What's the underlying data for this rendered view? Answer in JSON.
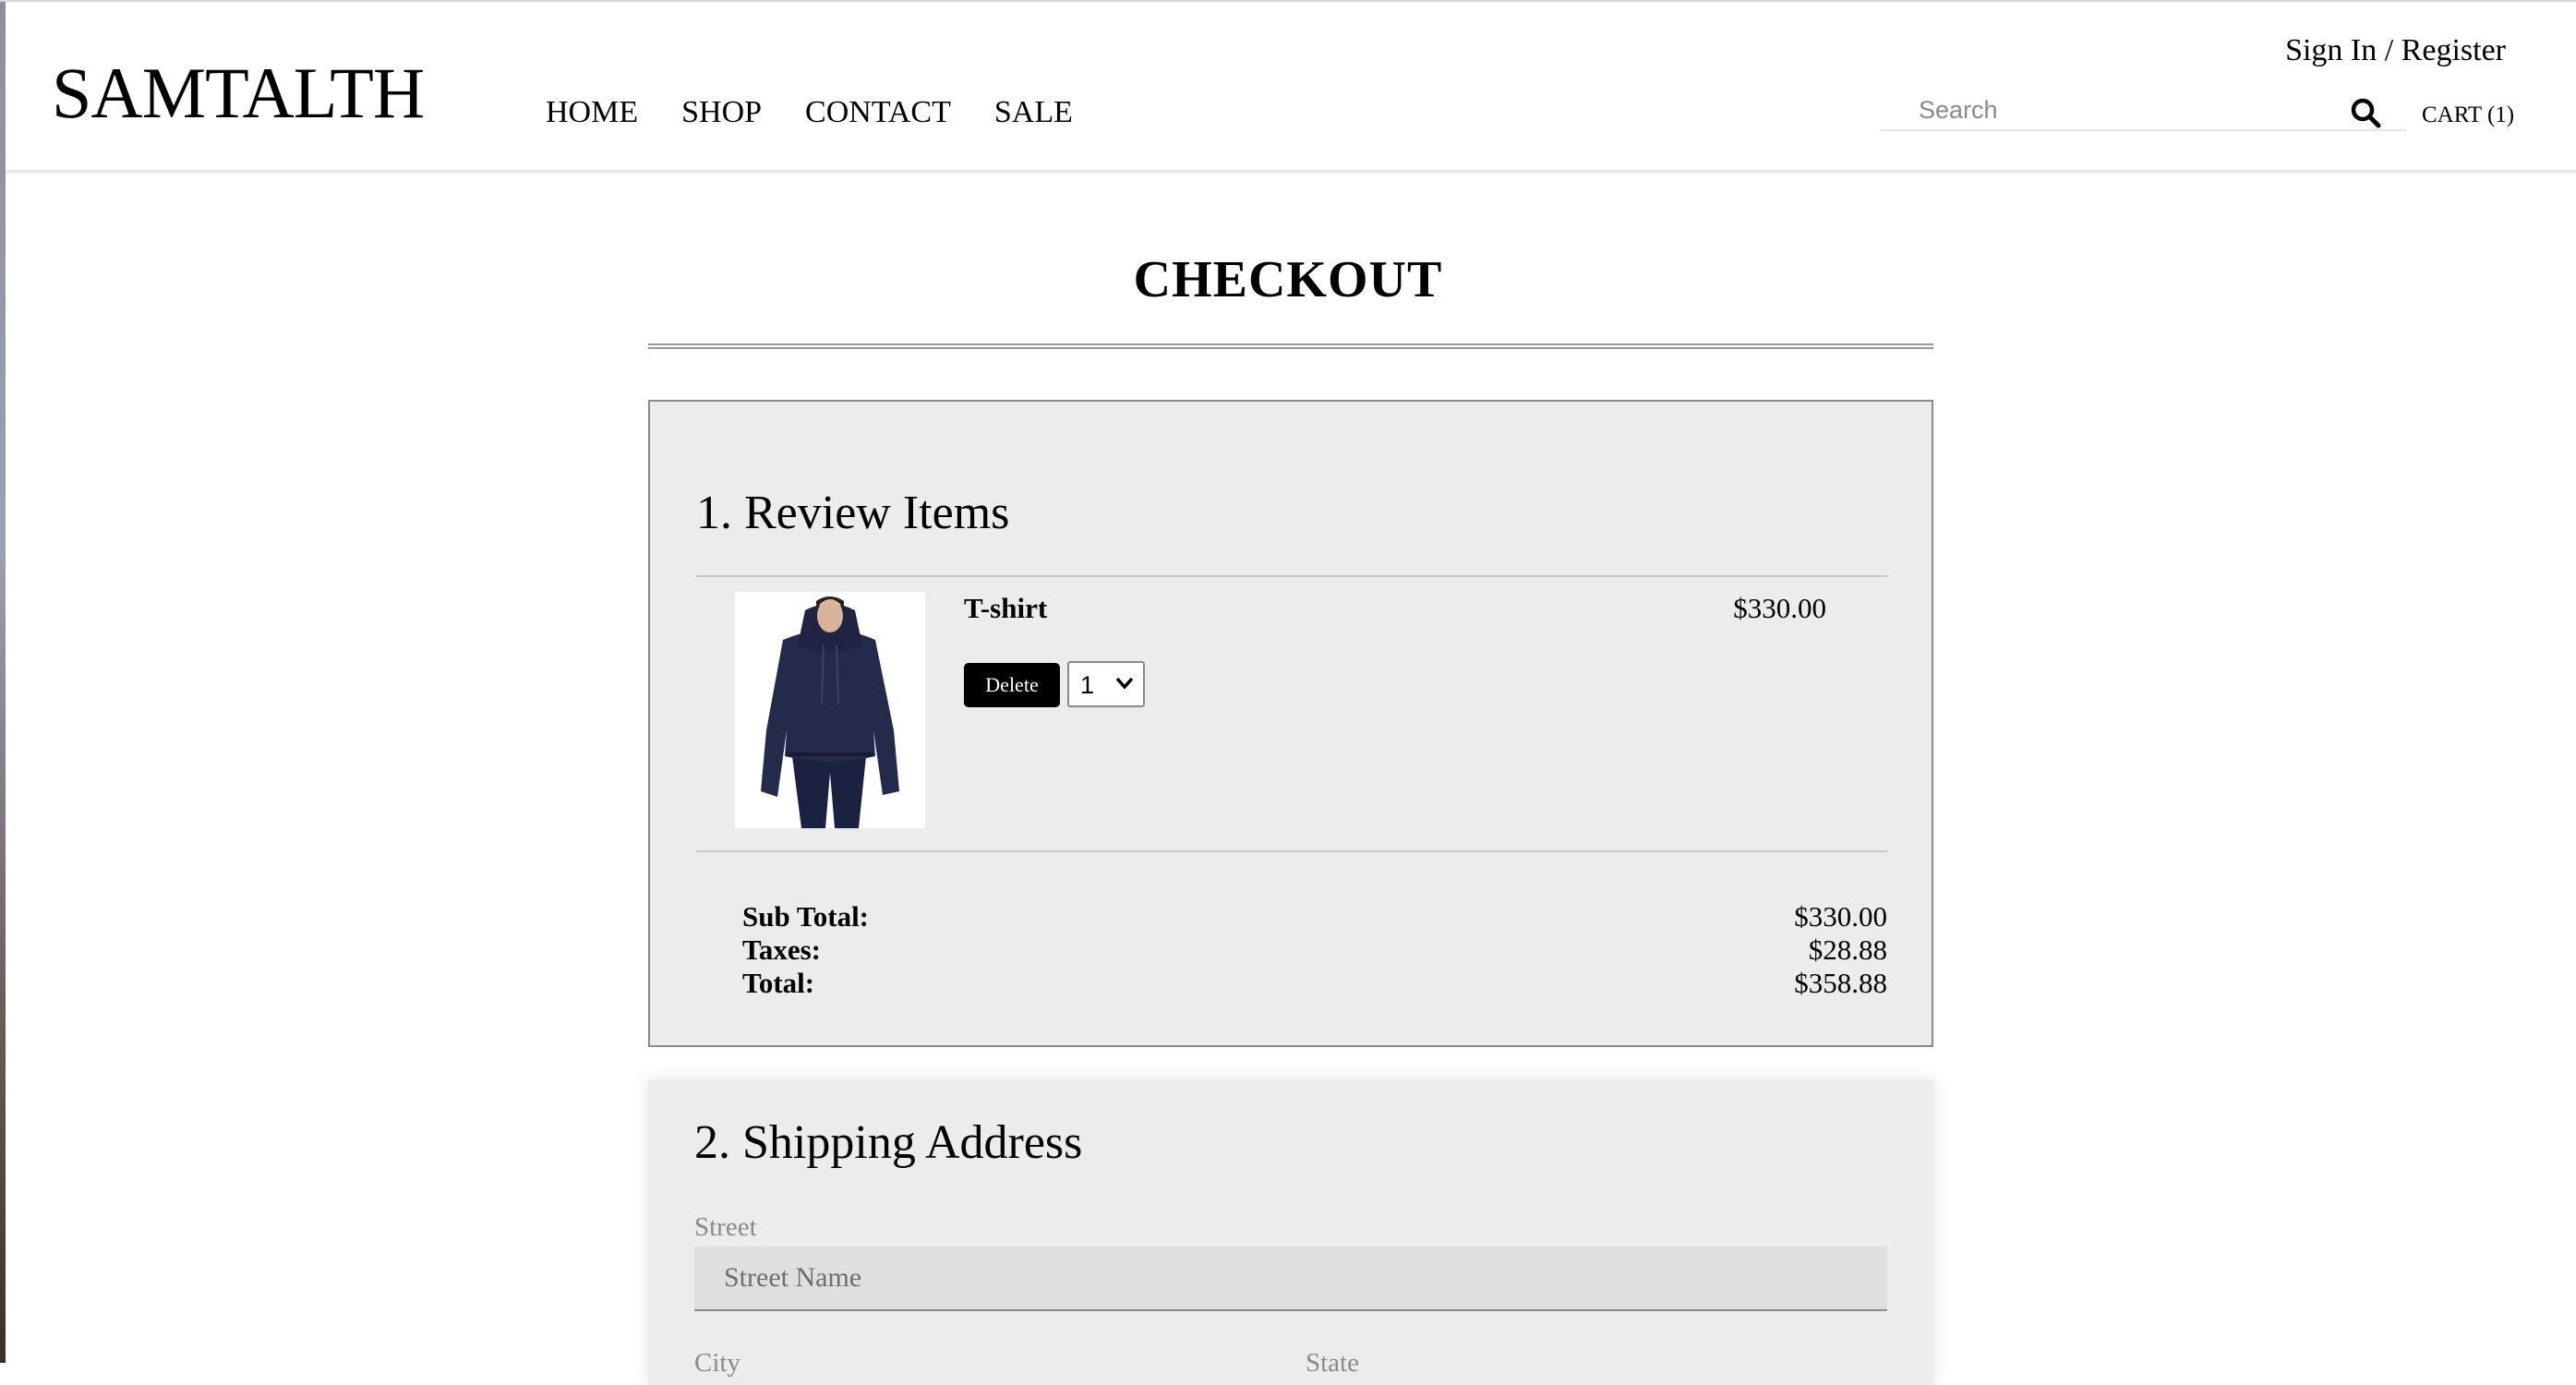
{
  "brand": {
    "logo": "SAMTALTH"
  },
  "nav": {
    "items": [
      "HOME",
      "SHOP",
      "CONTACT",
      "SALE"
    ]
  },
  "account": {
    "signin_label": "Sign In / Register"
  },
  "search": {
    "placeholder": "Search",
    "icon": "search-icon"
  },
  "cart": {
    "label": "CART (1)"
  },
  "page": {
    "title": "CHECKOUT"
  },
  "review": {
    "title": "1. Review Items",
    "items": [
      {
        "name": "T-shirt",
        "price": "$330.00",
        "delete_label": "Delete",
        "quantity": "1",
        "image": "navy hoodie product photo"
      }
    ],
    "totals": [
      {
        "label": "Sub Total:",
        "value": "$330.00"
      },
      {
        "label": "Taxes:",
        "value": "$28.88"
      },
      {
        "label": "Total:",
        "value": "$358.88"
      }
    ]
  },
  "shipping": {
    "title": "2. Shipping Address",
    "street_label": "Street",
    "street_placeholder": "Street Name",
    "city_label": "City",
    "state_label": "State"
  },
  "colors": {
    "accent": "#000000",
    "panel_bg": "#ececec",
    "input_bg": "#dfdfe1"
  }
}
